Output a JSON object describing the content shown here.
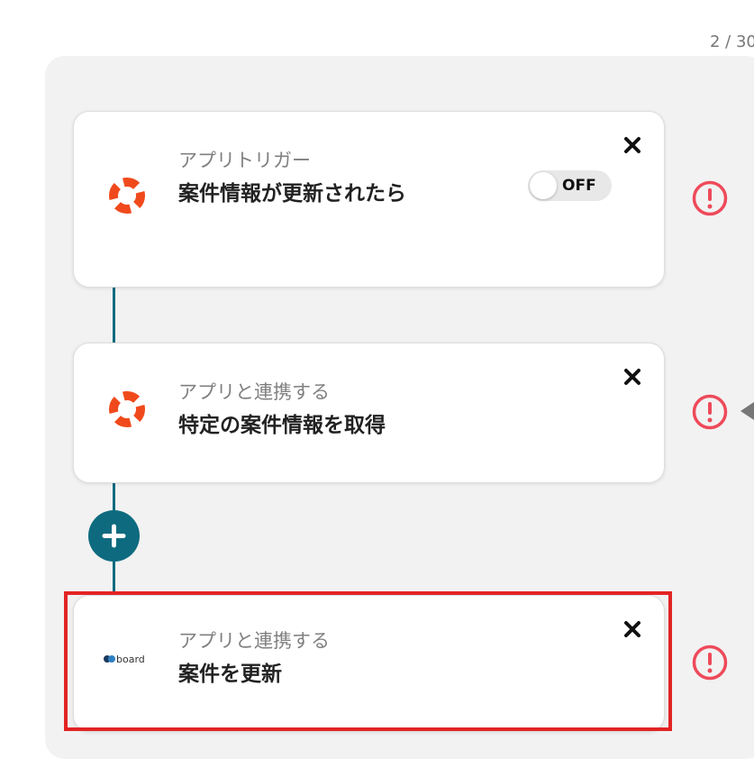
{
  "page": {
    "counter": "2 / 30"
  },
  "flow": {
    "steps": [
      {
        "sub": "アプリトリガー",
        "title": "案件情報が更新されたら",
        "app_icon": "lifebuoy-icon",
        "toggle": {
          "label": "OFF",
          "state": "off"
        }
      },
      {
        "sub": "アプリと連携する",
        "title": "特定の案件情報を取得",
        "app_icon": "lifebuoy-icon"
      },
      {
        "sub": "アプリと連携する",
        "title": "案件を更新",
        "app_icon": "board-logo",
        "highlighted": true
      }
    ],
    "close_icon": "close-icon",
    "warning_icon": "warning-icon",
    "add_icon": "plus-icon"
  },
  "colors": {
    "accent": "#0e6b7f",
    "warning": "#ee4a5a",
    "highlight": "#e32424",
    "lifebuoy": "#f04a1c"
  }
}
